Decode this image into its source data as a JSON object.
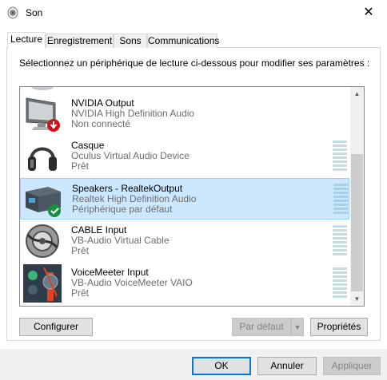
{
  "window": {
    "title": "Son",
    "close_glyph": "✕"
  },
  "tabs": [
    {
      "label": "Lecture",
      "active": true
    },
    {
      "label": "Enregistrement",
      "active": false
    },
    {
      "label": "Sons",
      "active": false
    },
    {
      "label": "Communications",
      "active": false
    }
  ],
  "instruction": "Sélectionnez un périphérique de lecture ci-dessous pour modifier ses paramètres :",
  "devices": [
    {
      "name": "NVIDIA Output",
      "driver": "NVIDIA High Definition Audio",
      "status": "Non connecté",
      "icon": "monitor-icon",
      "badge": "disconnected-arrow-icon",
      "selected": false
    },
    {
      "name": "Casque",
      "driver": "Oculus Virtual Audio Device",
      "status": "Prêt",
      "icon": "headphones-icon",
      "selected": false
    },
    {
      "name": "Speakers - RealtekOutput",
      "driver": "Realtek High Definition Audio",
      "status": "Périphérique par défaut",
      "icon": "speaker-box-icon",
      "badge": "default-check-icon",
      "selected": true
    },
    {
      "name": "CABLE Input",
      "driver": "VB-Audio Virtual Cable",
      "status": "Prêt",
      "icon": "cable-icon",
      "selected": false
    },
    {
      "name": "VoiceMeeter Input",
      "driver": "VB-Audio VoiceMeeter VAIO",
      "status": "Prêt",
      "icon": "voicemeeter-icon",
      "selected": false
    }
  ],
  "buttons": {
    "configure": "Configurer",
    "set_default": "Par défaut",
    "properties": "Propriétés",
    "ok": "OK",
    "cancel": "Annuler",
    "apply": "Appliquer"
  },
  "colors": {
    "selection": "#cce8ff",
    "selection_border": "#99d1ff",
    "accent": "#0078d7",
    "check_green": "#1a8f3c",
    "disconnected_red": "#d1101b"
  }
}
